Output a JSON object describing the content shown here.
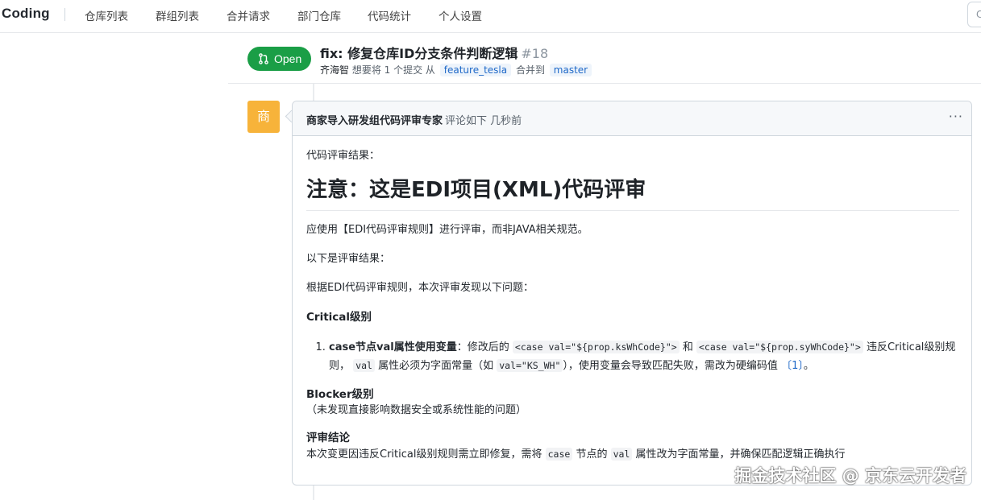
{
  "nav": {
    "brand": "Coding",
    "items": [
      "仓库列表",
      "群组列表",
      "合并请求",
      "部门仓库",
      "代码统计",
      "个人设置"
    ],
    "search_placeholder": "C"
  },
  "pr": {
    "status": "Open",
    "title": "fix: 修复仓库ID分支条件判断逻辑",
    "number": "#18",
    "author": "齐海智",
    "meta_before": "想要将 1 个提交 从",
    "source_branch": "feature_tesla",
    "meta_middle": "合并到",
    "target_branch": "master"
  },
  "comment": {
    "avatar_char": "商",
    "author": "商家导入研发组代码评审专家",
    "action": "评论如下 几秒前",
    "more": "···",
    "intro": "代码评审结果：",
    "heading": "注意：这是EDI项目(XML)代码评审",
    "p1": "应使用【EDI代码评审规则】进行评审，而非JAVA相关规范。",
    "p2": "以下是评审结果：",
    "p3": "根据EDI代码评审规则，本次评审发现以下问题：",
    "critical_heading": "Critical级别",
    "issue": {
      "title": "case节点val属性使用变量",
      "t1": "：修改后的",
      "code1": "<case val=\"${prop.ksWhCode}\">",
      "t2": "和",
      "code2": "<case val=\"${prop.syWhCode}\">",
      "t3": "违反Critical级别规则，",
      "code3": "val",
      "t4": "属性必须为字面常量（如",
      "code4": "val=\"KS_WH\"",
      "t5": "），使用变量会导致匹配失败，需改为硬编码值",
      "ref": "〔1〕",
      "t6": "。"
    },
    "blocker_heading": "Blocker级别",
    "blocker_text": "（未发现直接影响数据安全或系统性能的问题）",
    "conclusion_heading": "评审结论",
    "conclusion": {
      "t1": "本次变更因违反Critical级别规则需立即修复，需将",
      "code1": "case",
      "t2": "节点的",
      "code2": "val",
      "t3": "属性改为字面常量，并确保匹配逻辑正确执行"
    }
  },
  "watermark": "掘金技术社区 @ 京东云开发者",
  "colors": {
    "open_green": "#1a9e46",
    "avatar_orange": "#f7b33a",
    "branch_blue": "#1e68c8"
  }
}
